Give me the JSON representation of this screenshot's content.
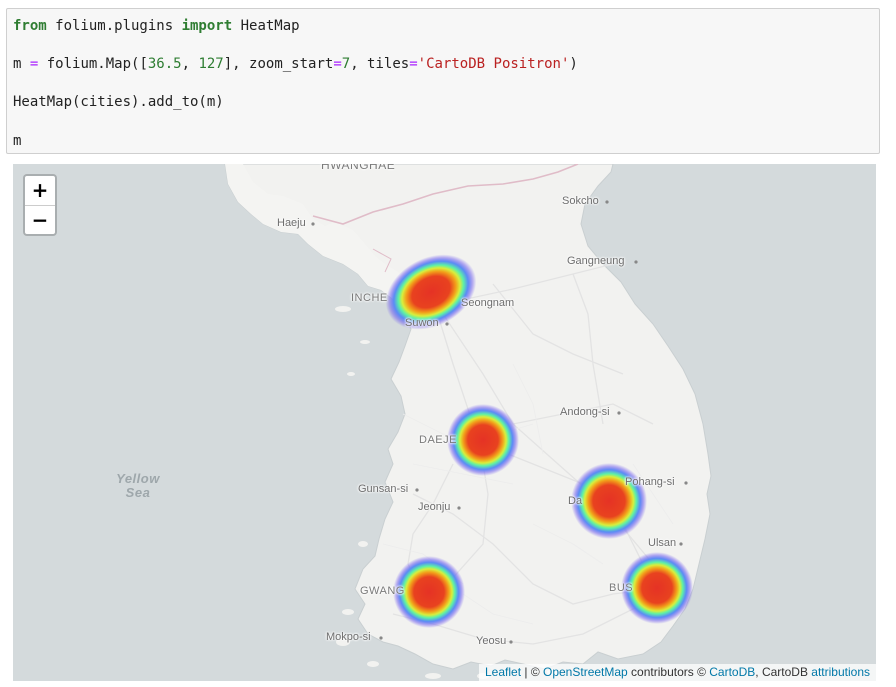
{
  "code": {
    "line1": {
      "kw1": "from",
      "module": " folium.plugins ",
      "kw2": "import",
      "name": " HeatMap"
    },
    "line2": {
      "p1": "m ",
      "eq": "=",
      "p2": " folium.Map([",
      "n1": "36.5",
      "p3": ", ",
      "n2": "127",
      "p4": "], zoom_start",
      "eq2": "=",
      "n3": "7",
      "p5": ", tiles",
      "eq3": "=",
      "s1": "'CartoDB Positron'",
      "p6": ")"
    },
    "line3": "HeatMap(cities).add_to(m)",
    "line4": "m"
  },
  "map": {
    "zoom_in_label": "+",
    "zoom_out_label": "−",
    "sea_label_line1": "Yellow",
    "sea_label_line2": "Sea",
    "places": {
      "hwanghae": "HWANGHAE",
      "haeju": "Haeju",
      "sokcho": "Sokcho",
      "gangneung": "Gangneung",
      "incheon": "INCHE",
      "seongnam": "Seongnam",
      "suwon": "Suwon",
      "andong": "Andong-si",
      "daejeon": "DAEJE",
      "pohang": "Pohang-si",
      "gunsan": "Gunsan-si",
      "jeonju": "Jeonju",
      "daegu": "Da",
      "ulsan": "Ulsan",
      "gwangju": "GWANG",
      "busan": "BUS",
      "mokpo": "Mokpo-si",
      "yeosu": "Yeosu"
    },
    "heat_spots": [
      {
        "name": "seoul",
        "intensity": 1.0
      },
      {
        "name": "daejeon",
        "intensity": 0.8
      },
      {
        "name": "daegu",
        "intensity": 0.8
      },
      {
        "name": "gwangju",
        "intensity": 0.8
      },
      {
        "name": "busan",
        "intensity": 0.8
      }
    ],
    "colors": {
      "water": "#d4dadc",
      "land": "#f2f2f0",
      "heat_core": "#e53225"
    }
  },
  "attribution": {
    "leaflet": "Leaflet",
    "sep1": " | © ",
    "osm": "OpenStreetMap",
    "contributors": " contributors © ",
    "cartodb": "CartoDB",
    "sep2": ", CartoDB ",
    "attributions": "attributions"
  }
}
